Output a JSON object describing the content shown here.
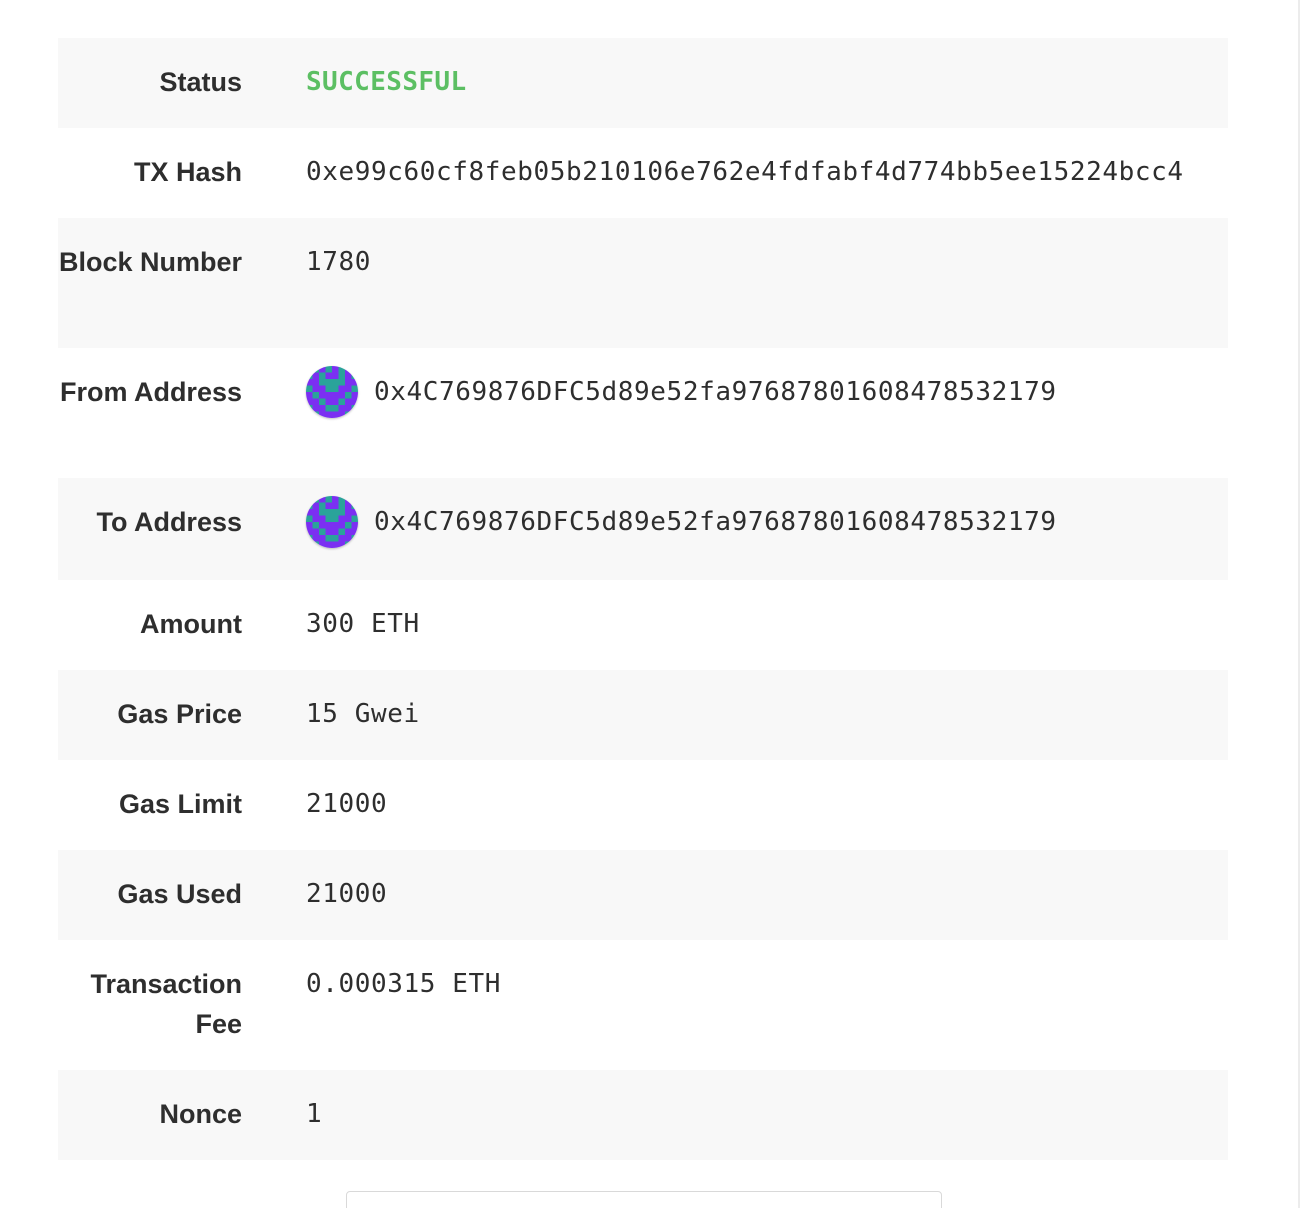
{
  "transaction": {
    "status": {
      "label": "Status",
      "value": "SUCCESSFUL"
    },
    "tx_hash": {
      "label": "TX Hash",
      "value": "0xe99c60cf8feb05b210106e762e4fdfabf4d774bb5ee15224bcc4"
    },
    "block_number": {
      "label": "Block Number",
      "value": "1780"
    },
    "from_address": {
      "label": "From Address",
      "value": "0x4C769876DFC5d89e52fa97687801608478532179"
    },
    "to_address": {
      "label": "To Address",
      "value": "0x4C769876DFC5d89e52fa97687801608478532179"
    },
    "amount": {
      "label": "Amount",
      "value": "300 ETH"
    },
    "gas_price": {
      "label": "Gas Price",
      "value": "15 Gwei"
    },
    "gas_limit": {
      "label": "Gas Limit",
      "value": "21000"
    },
    "gas_used": {
      "label": "Gas Used",
      "value": "21000"
    },
    "transaction_fee": {
      "label": "Transaction Fee",
      "value": "0.000315 ETH"
    },
    "nonce": {
      "label": "Nonce",
      "value": "1"
    }
  },
  "colors": {
    "success": "#5cbf63",
    "row_shade": "#f8f8f8",
    "text": "#2e2e2e",
    "identicon_primary": "#7b2ff2",
    "identicon_secondary": "#2aa39a"
  },
  "icons": {
    "from_address": "identicon-avatar-icon",
    "to_address": "identicon-avatar-icon"
  }
}
